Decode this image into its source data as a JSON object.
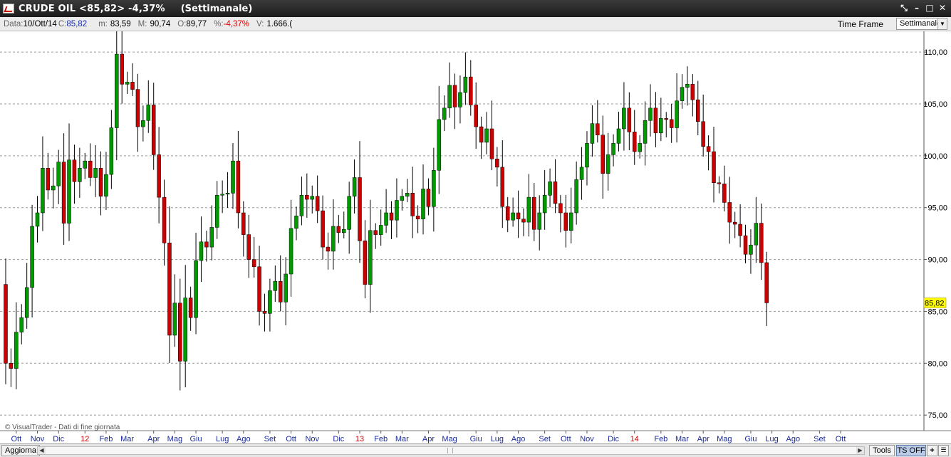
{
  "window": {
    "title": "CRUDE OIL <85,82> -4,37%",
    "timeframe_title": "(Settimanale)",
    "controls": [
      "⤡",
      "–",
      "□",
      "✕"
    ]
  },
  "infobar": {
    "date_label": "Data:",
    "date_value": "10/Ott/14",
    "close_label": "C:",
    "close_value": "85,82",
    "min_label": "m:",
    "min_value": "83,59",
    "max_label": "M:",
    "max_value": "90,74",
    "open_label": "O:",
    "open_value": "89,77",
    "pct_label": "%:",
    "pct_value": "-4,37%",
    "vol_label": "V:",
    "vol_value": "1.666.("
  },
  "timeframe": {
    "label": "Time Frame",
    "selected": "Settimanale"
  },
  "bottombar": {
    "refresh": "Aggiorna",
    "tools": "Tools",
    "ts": "TS OFF",
    "plus": "+"
  },
  "colors": {
    "up": "#009900",
    "down": "#cc0000",
    "grid": "#9a9a9a",
    "last_price_bg": "#ffff00"
  },
  "chart_data": {
    "type": "candlestick",
    "watermark": "© VisualTrader - Dati di fine giornata",
    "ylim": [
      73.5,
      112
    ],
    "ygrid": [
      75,
      80,
      85,
      90,
      95,
      100,
      105,
      110
    ],
    "ytick_labels": [
      "75,00",
      "80,00",
      "85,00",
      "90,00",
      "95,00",
      "100,00",
      "105,00",
      "110,00"
    ],
    "last_price": 85.82,
    "last_price_label": "85,82",
    "x_labels": [
      {
        "label": "Ott",
        "bar": 2,
        "year": false
      },
      {
        "label": "Nov",
        "bar": 6,
        "year": false
      },
      {
        "label": "Dic",
        "bar": 10,
        "year": false
      },
      {
        "label": "12",
        "bar": 15,
        "year": true
      },
      {
        "label": "Feb",
        "bar": 19,
        "year": false
      },
      {
        "label": "Mar",
        "bar": 23,
        "year": false
      },
      {
        "label": "Apr",
        "bar": 28,
        "year": false
      },
      {
        "label": "Mag",
        "bar": 32,
        "year": false
      },
      {
        "label": "Giu",
        "bar": 36,
        "year": false
      },
      {
        "label": "Lug",
        "bar": 41,
        "year": false
      },
      {
        "label": "Ago",
        "bar": 45,
        "year": false
      },
      {
        "label": "Set",
        "bar": 50,
        "year": false
      },
      {
        "label": "Ott",
        "bar": 54,
        "year": false
      },
      {
        "label": "Nov",
        "bar": 58,
        "year": false
      },
      {
        "label": "Dic",
        "bar": 63,
        "year": false
      },
      {
        "label": "13",
        "bar": 67,
        "year": true
      },
      {
        "label": "Feb",
        "bar": 71,
        "year": false
      },
      {
        "label": "Mar",
        "bar": 75,
        "year": false
      },
      {
        "label": "Apr",
        "bar": 80,
        "year": false
      },
      {
        "label": "Mag",
        "bar": 84,
        "year": false
      },
      {
        "label": "Giu",
        "bar": 89,
        "year": false
      },
      {
        "label": "Lug",
        "bar": 93,
        "year": false
      },
      {
        "label": "Ago",
        "bar": 97,
        "year": false
      },
      {
        "label": "Set",
        "bar": 102,
        "year": false
      },
      {
        "label": "Ott",
        "bar": 106,
        "year": false
      },
      {
        "label": "Nov",
        "bar": 110,
        "year": false
      },
      {
        "label": "Dic",
        "bar": 115,
        "year": false
      },
      {
        "label": "14",
        "bar": 119,
        "year": true
      },
      {
        "label": "Feb",
        "bar": 124,
        "year": false
      },
      {
        "label": "Mar",
        "bar": 128,
        "year": false
      },
      {
        "label": "Apr",
        "bar": 132,
        "year": false
      },
      {
        "label": "Mag",
        "bar": 136,
        "year": false
      },
      {
        "label": "Giu",
        "bar": 141,
        "year": false
      },
      {
        "label": "Lug",
        "bar": 145,
        "year": false
      },
      {
        "label": "Ago",
        "bar": 149,
        "year": false
      },
      {
        "label": "Set",
        "bar": 154,
        "year": false
      },
      {
        "label": "Ott",
        "bar": 158,
        "year": false
      }
    ],
    "closes": [
      80.0,
      79.5,
      83.0,
      84.4,
      87.3,
      93.2,
      94.5,
      98.8,
      96.7,
      97.1,
      99.4,
      93.5,
      99.6,
      97.5,
      98.8,
      99.5,
      97.9,
      98.8,
      96.1,
      98.2,
      102.7,
      109.8,
      106.9,
      107.1,
      106.4,
      102.8,
      103.4,
      104.9,
      100.1,
      96.0,
      91.6,
      82.7,
      85.8,
      80.2,
      86.3,
      84.4,
      89.9,
      91.7,
      91.2,
      93.1,
      96.2,
      96.3,
      96.4,
      99.5,
      94.5,
      92.4,
      90.0,
      89.3,
      85.0,
      84.8,
      87.0,
      87.9,
      85.9,
      88.6,
      93.0,
      94.2,
      96.2,
      95.8,
      96.1,
      94.7,
      91.2,
      90.8,
      93.2,
      92.6,
      92.9,
      96.1,
      97.9,
      91.8,
      87.6,
      92.8,
      92.4,
      93.3,
      94.5,
      93.8,
      95.7,
      96.1,
      96.4,
      94.2,
      93.9,
      96.8,
      95.1,
      98.6,
      103.5,
      104.6,
      106.8,
      104.7,
      106.1,
      107.6,
      104.9,
      102.8,
      101.3,
      102.6,
      99.7,
      98.9,
      95.1,
      93.8,
      94.5,
      93.9,
      93.6,
      96.0,
      92.9,
      94.5,
      96.2,
      97.5,
      95.4,
      94.5,
      92.8,
      94.5,
      97.7,
      98.9,
      101.2,
      103.1,
      102.0,
      98.3,
      100.1,
      101.2,
      102.6,
      104.6,
      102.3,
      100.4,
      101.2,
      103.4,
      104.6,
      102.2,
      103.6,
      103.5,
      102.7,
      105.3,
      106.6,
      106.9,
      105.4,
      103.3,
      100.9,
      100.4,
      97.4,
      97.3,
      95.5,
      93.6,
      93.4,
      92.3,
      90.5,
      91.4,
      93.5,
      89.7,
      85.82
    ],
    "notes": "weekly bars, first open 87.6"
  }
}
